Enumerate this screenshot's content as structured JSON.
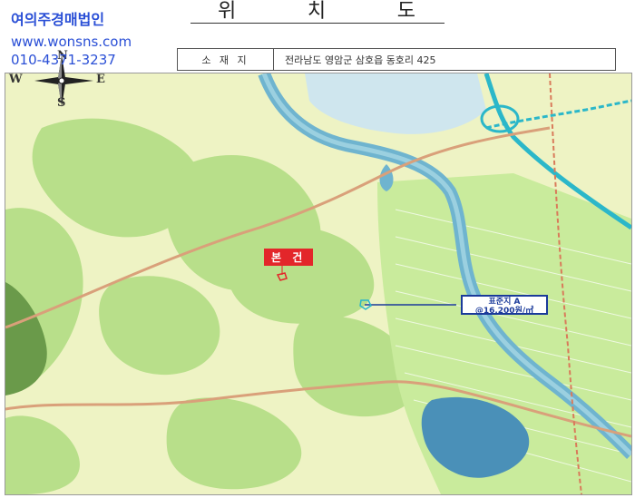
{
  "title": {
    "chars": [
      "위",
      "치",
      "도"
    ]
  },
  "firm": {
    "name": "여의주경매법인",
    "website": "www.wonsns.com",
    "phone": "010-4371-3237"
  },
  "address_table": {
    "label": "소 재 지",
    "value": "전라남도 영암군 삼호읍 동호리 425"
  },
  "compass": {
    "north": "N",
    "south": "S",
    "east": "E",
    "west": "W"
  },
  "map": {
    "subject_label": "본 건",
    "standard_land": {
      "name": "표준지 A",
      "price": "@16,200원/㎡"
    }
  },
  "colors": {
    "firm_text": "#2a4fd6",
    "subject_label_bg": "#e3262a",
    "standard_box_border": "#1a3a9a",
    "river": "#6fb4cf",
    "green_area": "#b8df8a",
    "farmland": "#c9eb9c",
    "highway": "#2bb7c9",
    "road": "#d9a07a"
  }
}
